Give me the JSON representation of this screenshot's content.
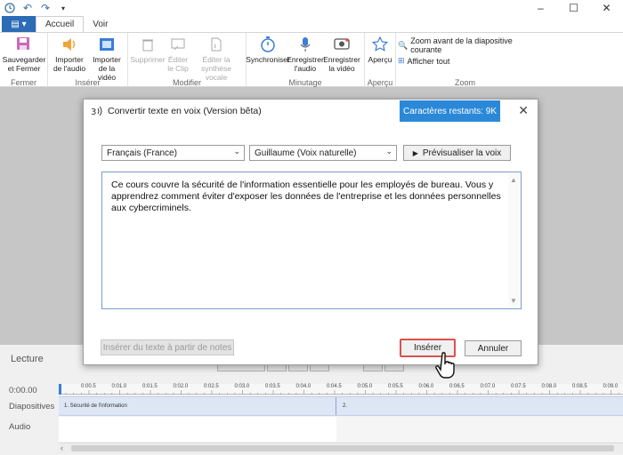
{
  "qat": {
    "icons": [
      "save-icon",
      "undo-icon",
      "redo-icon",
      "more-icon"
    ]
  },
  "window": {
    "minimize": "–",
    "maximize": "☐",
    "close": "✕"
  },
  "tabs": {
    "file": "▤ ▾",
    "home": "Accueil",
    "view": "Voir"
  },
  "ribbon": {
    "groups": {
      "fermer": {
        "label": "Fermer",
        "save_close": "Sauvegarder et Fermer"
      },
      "inserer": {
        "label": "Insérer",
        "import_audio": "Importer de l'audio",
        "import_video": "Importer de la vidéo"
      },
      "modifier": {
        "label": "Modifier",
        "delete": "Supprimer",
        "edit_clip": "Éditer le Clip",
        "edit_tts": "Éditer la synthèse vocale"
      },
      "minutage": {
        "label": "Minutage",
        "sync": "Synchroniser",
        "rec_audio": "Enregistrer l'audio",
        "rec_video": "Enregistrer la vidéo"
      },
      "apercu": {
        "label": "Aperçu",
        "preview": "Aperçu"
      },
      "zoom": {
        "label": "Zoom",
        "zoom_slide": "Zoom avant de la diapositive courante",
        "show_all": "Afficher tout"
      }
    }
  },
  "dialog": {
    "title": "Convertir texte en voix (Version bêta)",
    "remaining": "Caractères restants: 9K",
    "language": "Français (France)",
    "voice": "Guillaume (Voix naturelle)",
    "preview_btn": "Prévisualiser la voix",
    "text": "Ce cours couvre la sécurité de l'information essentielle pour les employés de bureau. Vous y apprendrez comment éviter d'exposer les données de l'entreprise et les données personnelles aux cybercriminels.",
    "notes_btn": "Insérer du texte à partir de notes",
    "insert_btn": "Insérer",
    "cancel_btn": "Annuler"
  },
  "timeline": {
    "lecture": "Lecture",
    "time": "0:00.00",
    "tracks": [
      "Diapositives",
      "Audio"
    ],
    "ticks": [
      "0:00.5",
      "0:01.0",
      "0:01.5",
      "0:02.0",
      "0:02.5",
      "0:03.0",
      "0:03.5",
      "0:04.0",
      "0:04.5",
      "0:05.0",
      "0:05.5",
      "0:06.0",
      "0:06.5",
      "0:07.0",
      "0:07.5",
      "0:08.0",
      "0:08.5",
      "0:09.0"
    ],
    "slides": [
      "1. Sécurité de l'information",
      "2."
    ]
  }
}
